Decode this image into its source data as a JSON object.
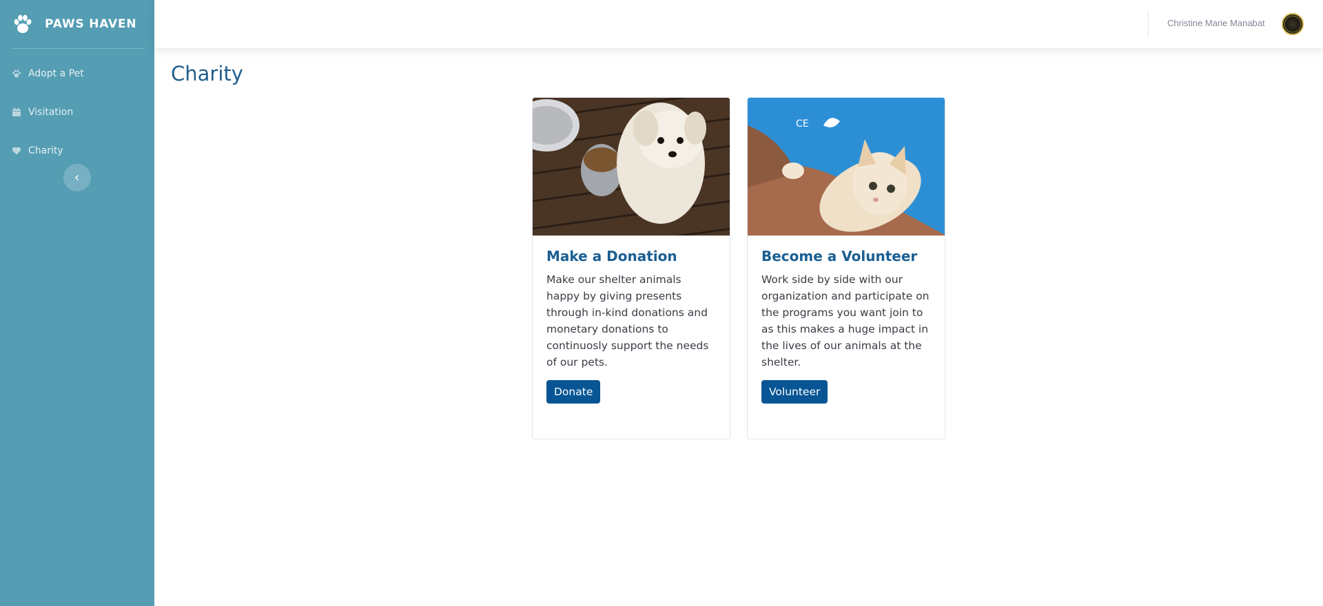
{
  "brand": {
    "name": "PAWS HAVEN",
    "icon": "paw-icon"
  },
  "sidebar": {
    "items": [
      {
        "label": "Adopt a Pet",
        "icon": "paw-icon"
      },
      {
        "label": "Visitation",
        "icon": "calendar-icon"
      },
      {
        "label": "Charity",
        "icon": "heart-icon"
      }
    ],
    "toggle_icon": "chevron-left-icon"
  },
  "topbar": {
    "user_name": "Christine Marie Manabat"
  },
  "page": {
    "title": "Charity"
  },
  "cards": [
    {
      "title": "Make a Donation",
      "text": "Make our shelter animals happy by giving presents through in-kind donations and monetary donations to continuosly support the needs of our pets.",
      "button": "Donate"
    },
    {
      "title": "Become a Volunteer",
      "text": "Work side by side with our organization and participate on the programs you want join to as this makes a huge impact in the lives of our animals at the shelter.",
      "button": "Volunteer"
    }
  ],
  "colors": {
    "sidebar": "#549db3",
    "accent": "#075594",
    "title": "#215e8c"
  }
}
